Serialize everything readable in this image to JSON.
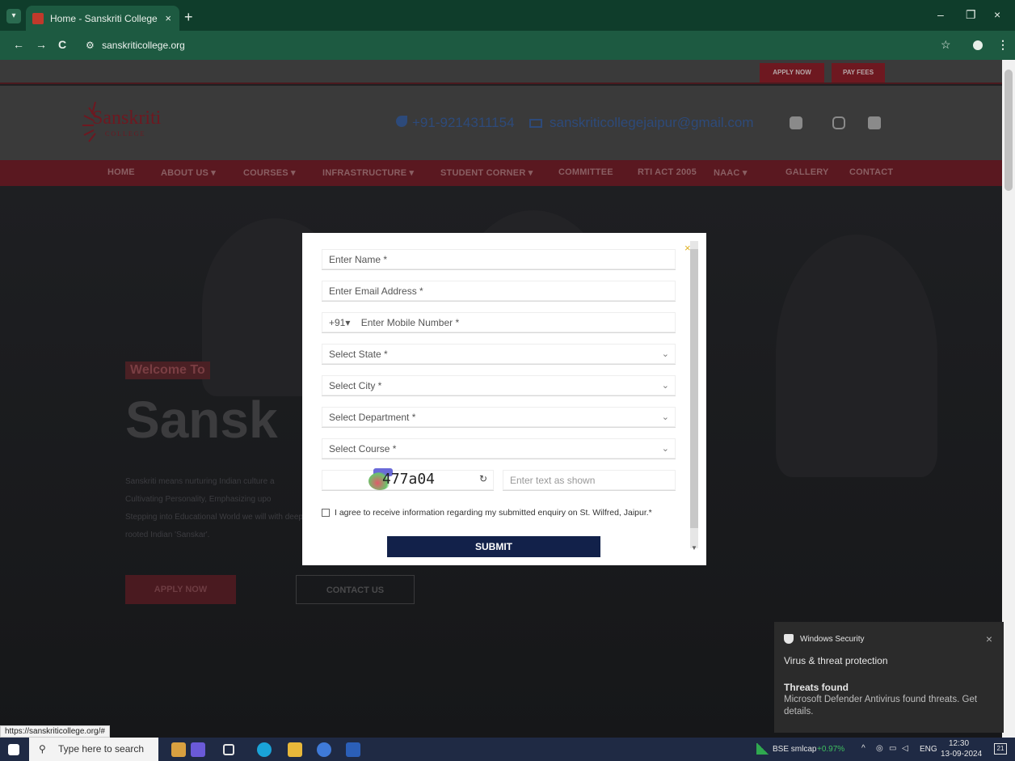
{
  "browser": {
    "tab_title": "Home - Sanskriti College",
    "tab_close": "×",
    "new_tab": "+",
    "url": "sanskriticollege.org",
    "back": "←",
    "forward": "→",
    "reload": "C",
    "star": "☆",
    "menu": "⋮",
    "minimize": "–",
    "restore": "❐",
    "close": "×"
  },
  "site": {
    "top_buttons": {
      "apply": "APPLY NOW",
      "pay": "PAY FEES"
    },
    "logo": {
      "name": "Sanskriti",
      "sub": "COLLEGE"
    },
    "phone": "+91-9214311154",
    "email": "sanskriticollegejaipur@gmail.com",
    "nav": [
      "HOME",
      "ABOUT US ▾",
      "COURSES ▾",
      "INFRASTRUCTURE ▾",
      "STUDENT CORNER ▾",
      "COMMITTEE",
      "RTI ACT 2005",
      "NAAC ▾",
      "GALLERY",
      "CONTACT"
    ],
    "hero": {
      "welcome": "Welcome To",
      "title": "Sansk",
      "paragraph": "Sanskriti means nurturing Indian culture a Cultivating Personality, Emphasizing upo Stepping into Educational World we will with deep rooted Indian 'Sanskar'.",
      "apply": "APPLY NOW",
      "contact": "CONTACT US"
    }
  },
  "modal": {
    "name_placeholder": "Enter Name *",
    "email_placeholder": "Enter Email Address *",
    "country_code": "+91▾",
    "mobile_placeholder": "Enter Mobile Number *",
    "state": "Select State *",
    "city": "Select City *",
    "department": "Select Department *",
    "course": "Select Course *",
    "captcha": "477a04",
    "captcha_placeholder": "Enter text as shown",
    "agree": "I agree to receive information regarding my submitted enquiry on St. Wilfred, Jaipur.*",
    "submit": "SUBMIT",
    "close": "×"
  },
  "toast": {
    "app": "Windows Security",
    "title": "Virus & threat protection",
    "heading": "Threats found",
    "body": "Microsoft Defender Antivirus found threats. Get details.",
    "close": "×"
  },
  "status_url": "https://sanskriticollege.org/#",
  "taskbar": {
    "search": "Type here to search",
    "ticker": "BSE smlcap",
    "ticker_change": "+0.97%",
    "lang": "ENG",
    "time": "12:30",
    "date": "13-09-2024",
    "notifications": "21"
  }
}
